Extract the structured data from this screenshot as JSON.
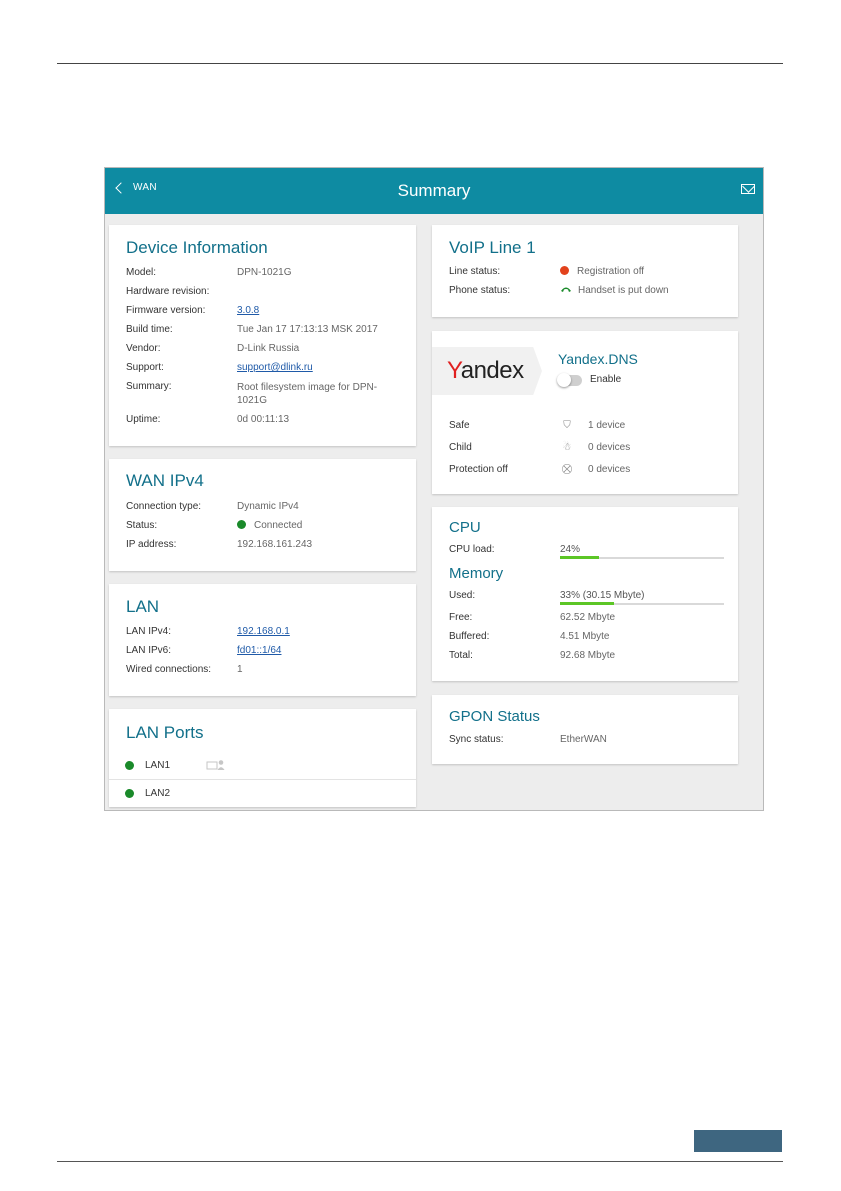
{
  "header": {
    "back_label": "WAN",
    "title": "Summary"
  },
  "device_info": {
    "title": "Device Information",
    "rows": [
      {
        "label": "Model:",
        "value": "DPN-1021G"
      },
      {
        "label": "Hardware revision:",
        "value": ""
      },
      {
        "label": "Firmware version:",
        "value": "3.0.8"
      },
      {
        "label": "Build time:",
        "value": "Tue Jan 17 17:13:13 MSK 2017"
      },
      {
        "label": "Vendor:",
        "value": "D-Link Russia"
      },
      {
        "label": "Support:",
        "value": "support@dlink.ru"
      },
      {
        "label": "Summary:",
        "value": "Root filesystem image for DPN-1021G"
      },
      {
        "label": "Uptime:",
        "value": "0d 00:11:13"
      }
    ]
  },
  "wan_ipv4": {
    "title": "WAN IPv4",
    "rows": [
      {
        "label": "Connection type:",
        "value": "Dynamic IPv4"
      },
      {
        "label": "Status:",
        "value": "Connected"
      },
      {
        "label": "IP address:",
        "value": "192.168.161.243"
      }
    ]
  },
  "lan": {
    "title": "LAN",
    "rows": [
      {
        "label": "LAN IPv4:",
        "value": "192.168.0.1"
      },
      {
        "label": "LAN IPv6:",
        "value": "fd01::1/64"
      },
      {
        "label": "Wired connections:",
        "value": "1"
      }
    ]
  },
  "lan_ports": {
    "title": "LAN Ports",
    "ports": [
      {
        "name": "LAN1"
      },
      {
        "name": "LAN2"
      }
    ]
  },
  "voip": {
    "title": "VoIP Line 1",
    "rows": [
      {
        "label": "Line status:",
        "value": "Registration off"
      },
      {
        "label": "Phone status:",
        "value": "Handset is put down"
      }
    ]
  },
  "yandex": {
    "logo_text_red": "Y",
    "logo_text_rest": "andex",
    "title": "Yandex.DNS",
    "enable_label": "Enable",
    "rows": [
      {
        "label": "Safe",
        "icon": "shield-check-icon",
        "value": "1 device"
      },
      {
        "label": "Child",
        "icon": "child-icon",
        "value": "0 devices"
      },
      {
        "label": "Protection off",
        "icon": "shield-x-icon",
        "value": "0 devices"
      }
    ]
  },
  "cpu": {
    "title": "CPU",
    "load_label": "CPU load:",
    "load_value": "24%",
    "load_fraction": 0.24
  },
  "memory": {
    "title": "Memory",
    "used_label": "Used:",
    "used_value": "33% (30.15 Mbyte)",
    "used_fraction": 0.33,
    "rows": [
      {
        "label": "Free:",
        "value": "62.52 Mbyte"
      },
      {
        "label": "Buffered:",
        "value": "4.51 Mbyte"
      },
      {
        "label": "Total:",
        "value": "92.68 Mbyte"
      }
    ]
  },
  "gpon": {
    "title": "GPON Status",
    "rows": [
      {
        "label": "Sync status:",
        "value": "EtherWAN"
      }
    ]
  },
  "colors": {
    "header": "#0e8ba2",
    "accent_title": "#12708a",
    "status_green": "#1a8a2a",
    "status_red": "#e2421c",
    "bar_green": "#5cc626"
  }
}
